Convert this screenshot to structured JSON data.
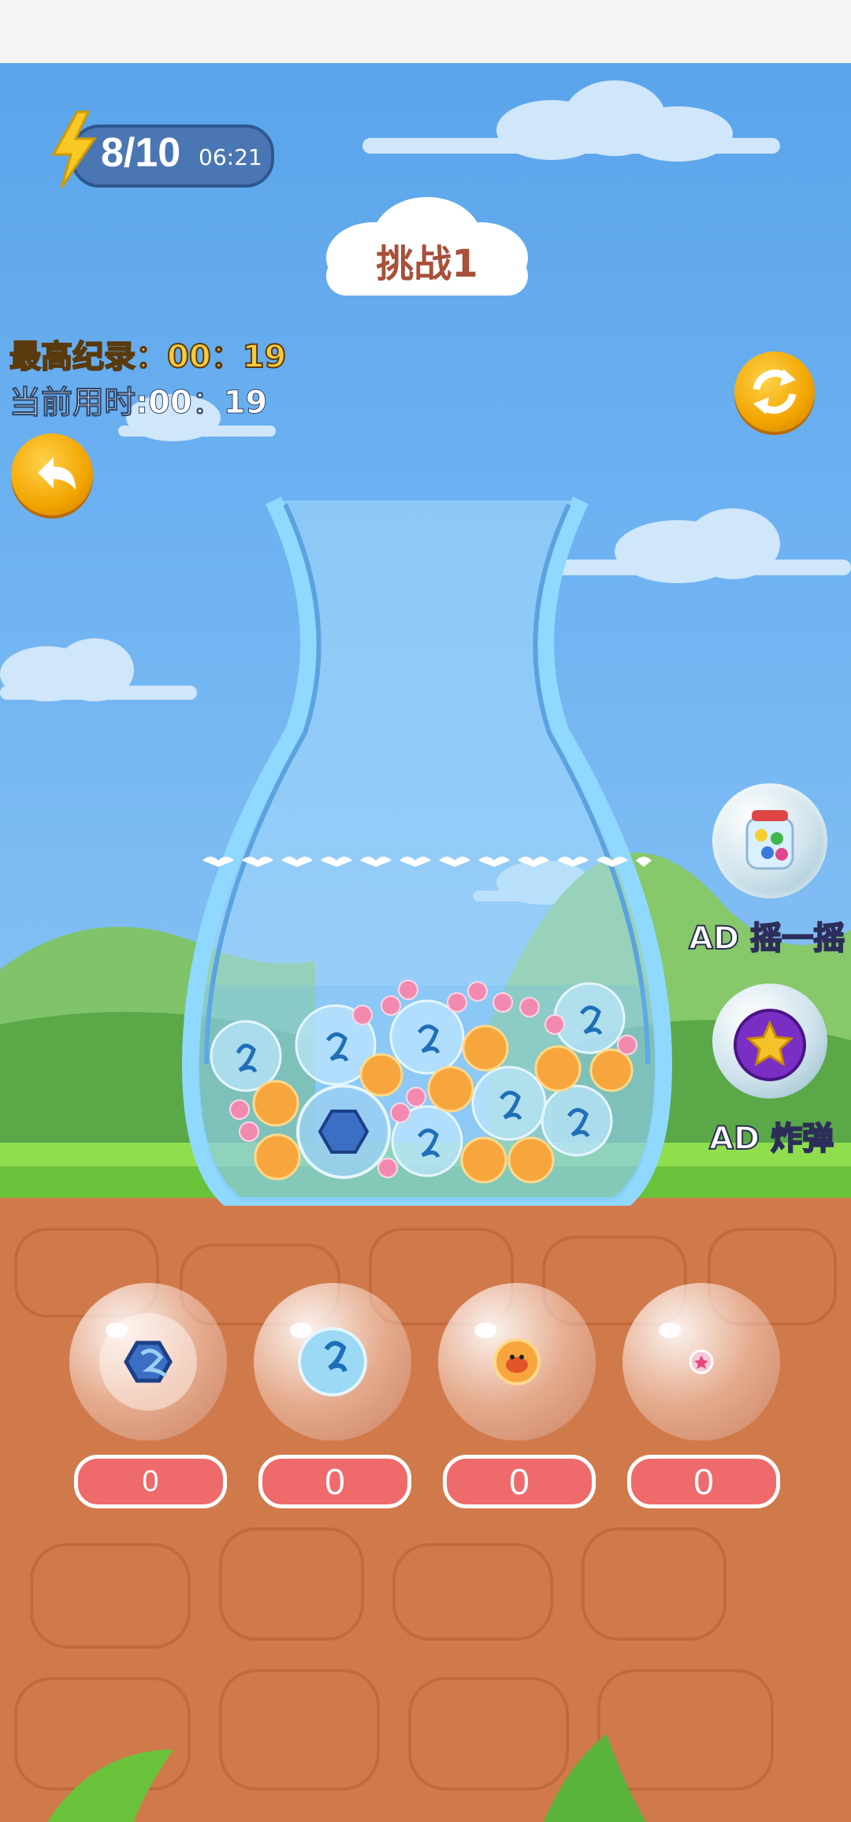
{
  "energy": {
    "count": "8/10",
    "timer": "06:21"
  },
  "level": {
    "title": "挑战1"
  },
  "stats": {
    "best_record": "最高纪录：00：19",
    "current_time": "当前用时:00：19"
  },
  "powerups": {
    "shake_label": "AD 摇一摇",
    "bomb_label": "AD 炸弹"
  },
  "collectors": [
    {
      "icon": "dragon-icon",
      "count": "0"
    },
    {
      "icon": "seahorse-icon",
      "count": "0"
    },
    {
      "icon": "crab-icon",
      "count": "0"
    },
    {
      "icon": "starfish-icon",
      "count": "0"
    }
  ],
  "colors": {
    "sky": "#6fb3f2",
    "vase": "#8fd8ff",
    "ground": "#d07a4c",
    "grass": "#6ac23a",
    "score_pill": "#ef6a6a"
  }
}
